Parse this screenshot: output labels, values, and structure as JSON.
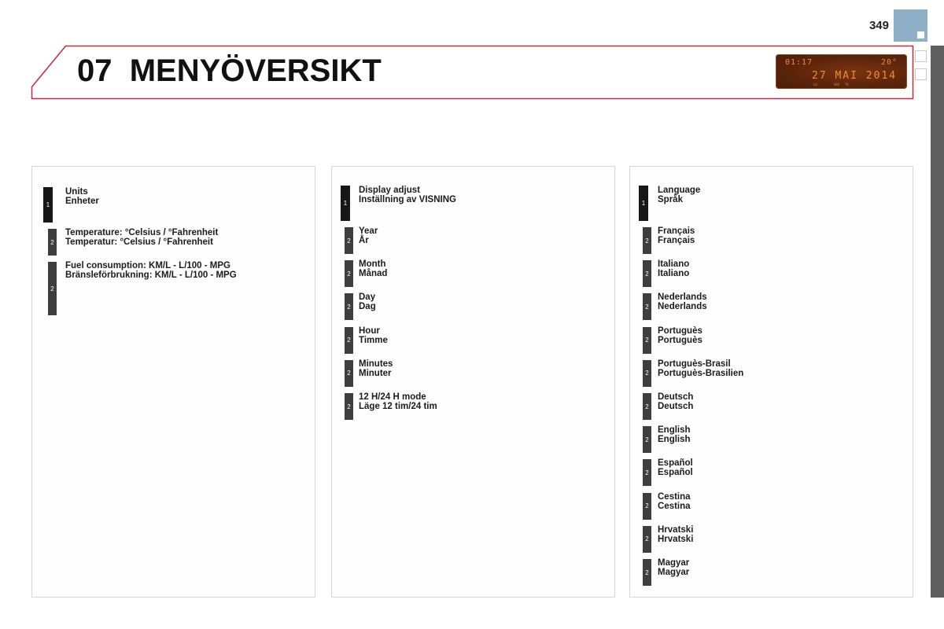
{
  "page": {
    "number": "349",
    "chapter_number": "07",
    "chapter_title": "MENYÖVERSIKT",
    "colors": {
      "header_border": "#c8283c",
      "corner_tab": "#8eb0c6",
      "side_bar": "#5f5f5f",
      "lcd_background": "#5a240a",
      "lcd_text": "#f08a3a",
      "badge_level1": "#171717",
      "badge_level2": "#3e3e3e"
    }
  },
  "lcd_display": {
    "time": "01:17",
    "temperature": "20°",
    "date": "27 MAI 2014",
    "small_labels": [
      "LQ",
      "ABS",
      "TA"
    ]
  },
  "panels": [
    {
      "name": "units",
      "items": [
        {
          "level": "1",
          "en": "Units",
          "sv": "Enheter"
        },
        {
          "level": "2",
          "en": "Temperature: °Celsius / °Fahrenheit",
          "sv": "Temperatur: °Celsius / °Fahrenheit"
        },
        {
          "level": "2",
          "en": "Fuel consumption: KM/L - L/100 - MPG",
          "sv": "Bränsleförbrukning: KM/L - L/100 - MPG"
        }
      ]
    },
    {
      "name": "display-adjust",
      "items": [
        {
          "level": "1",
          "en": "Display adjust",
          "sv": "Inställning av VISNING"
        },
        {
          "level": "2",
          "en": "Year",
          "sv": "År"
        },
        {
          "level": "2",
          "en": "Month",
          "sv": "Månad"
        },
        {
          "level": "2",
          "en": "Day",
          "sv": "Dag"
        },
        {
          "level": "2",
          "en": "Hour",
          "sv": "Timme"
        },
        {
          "level": "2",
          "en": "Minutes",
          "sv": "Minuter"
        },
        {
          "level": "2",
          "en": "12 H/24 H mode",
          "sv": "Läge 12 tim/24 tim"
        }
      ]
    },
    {
      "name": "language",
      "items": [
        {
          "level": "1",
          "en": "Language",
          "sv": "Språk"
        },
        {
          "level": "2",
          "en": "Français",
          "sv": "Français"
        },
        {
          "level": "2",
          "en": "Italiano",
          "sv": "Italiano"
        },
        {
          "level": "2",
          "en": "Nederlands",
          "sv": "Nederlands"
        },
        {
          "level": "2",
          "en": "Portuguès",
          "sv": "Portuguès"
        },
        {
          "level": "2",
          "en": "Portuguès-Brasil",
          "sv": "Portuguès-Brasilien"
        },
        {
          "level": "2",
          "en": "Deutsch",
          "sv": "Deutsch"
        },
        {
          "level": "2",
          "en": "English",
          "sv": "English"
        },
        {
          "level": "2",
          "en": "Español",
          "sv": "Español"
        },
        {
          "level": "2",
          "en": "Cestina",
          "sv": "Cestina"
        },
        {
          "level": "2",
          "en": "Hrvatski",
          "sv": "Hrvatski"
        },
        {
          "level": "2",
          "en": "Magyar",
          "sv": "Magyar"
        }
      ]
    }
  ]
}
